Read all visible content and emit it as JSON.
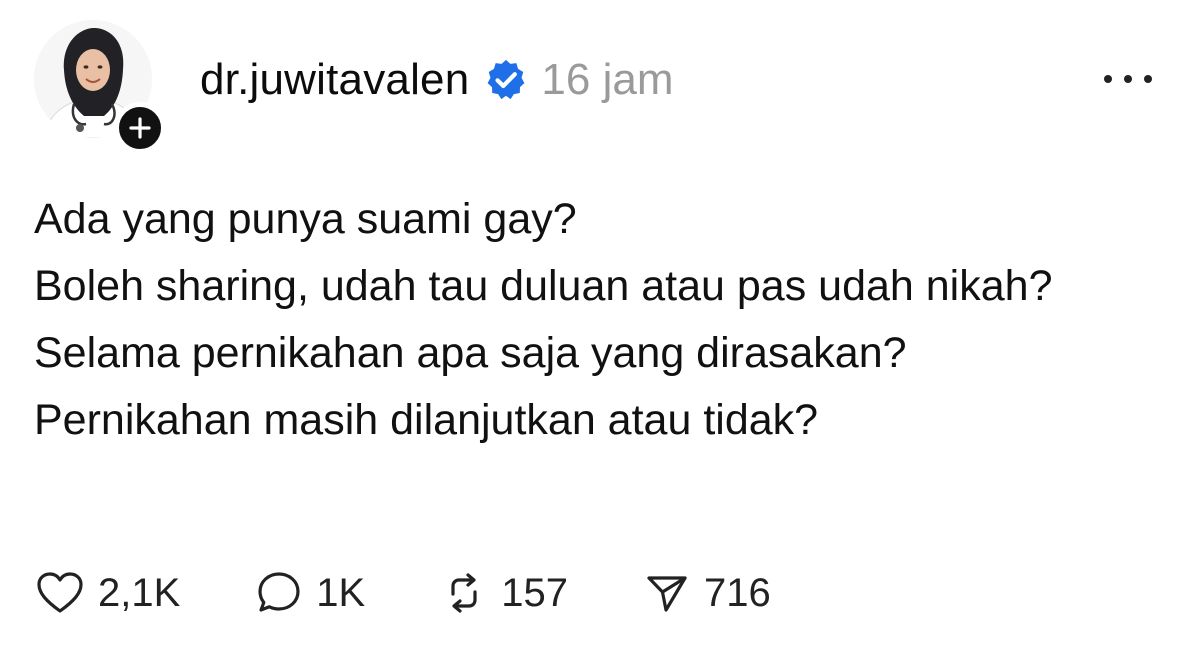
{
  "post": {
    "author": {
      "username": "dr.juwitavalen",
      "verified": true,
      "verified_icon": "verified-badge-icon",
      "avatar_icon": "avatar",
      "follow_icon": "plus-icon"
    },
    "timestamp": "16 jam",
    "more_icon": "more-dots-icon",
    "body_lines": [
      "Ada yang punya suami gay?",
      "Boleh sharing, udah tau duluan atau pas udah nikah?",
      "Selama pernikahan apa saja yang dirasakan?",
      "Pernikahan masih dilanjutkan atau tidak?"
    ],
    "actions": {
      "like": {
        "icon": "heart-icon",
        "count": "2,1K"
      },
      "reply": {
        "icon": "comment-icon",
        "count": "1K"
      },
      "repost": {
        "icon": "repost-icon",
        "count": "157"
      },
      "share": {
        "icon": "send-icon",
        "count": "716"
      }
    }
  },
  "colors": {
    "text": "#111111",
    "muted": "#9a9a9a",
    "verified_blue": "#1f6fe8",
    "background": "#ffffff"
  }
}
